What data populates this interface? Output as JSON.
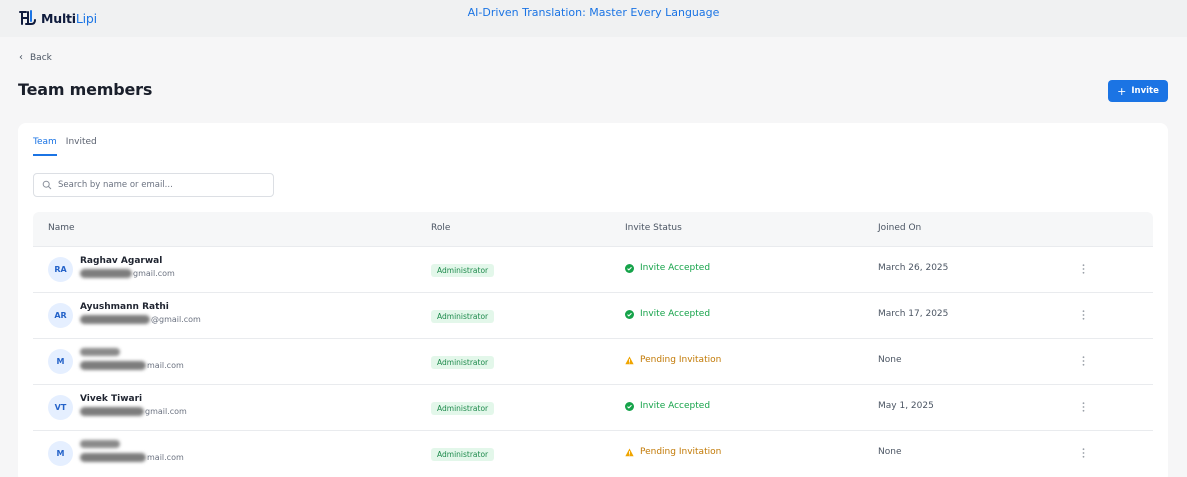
{
  "header": {
    "logo_main": "Multi",
    "logo_accent": "Lipi",
    "tagline": "AI-Driven Translation: Master Every Language"
  },
  "nav": {
    "back_label": "Back"
  },
  "page": {
    "title": "Team members",
    "invite_label": "Invite"
  },
  "tabs": [
    {
      "label": "Team",
      "active": true
    },
    {
      "label": "Invited",
      "active": false
    }
  ],
  "search": {
    "placeholder": "Search by name or email..."
  },
  "table": {
    "columns": [
      "Name",
      "Role",
      "Invite Status",
      "Joined On"
    ],
    "rows": [
      {
        "initials": "RA",
        "name": "Raghav Agarwal",
        "email_visible": "gmail.com",
        "role": "Administrator",
        "status": "Invite Accepted",
        "status_type": "accepted",
        "joined": "March 26, 2025"
      },
      {
        "initials": "AR",
        "name": "Ayushmann Rathi",
        "email_visible": "@gmail.com",
        "role": "Administrator",
        "status": "Invite Accepted",
        "status_type": "accepted",
        "joined": "March 17, 2025"
      },
      {
        "initials": "M",
        "name": "",
        "email_visible": "mail.com",
        "role": "Administrator",
        "status": "Pending Invitation",
        "status_type": "pending",
        "joined": "None"
      },
      {
        "initials": "VT",
        "name": "Vivek Tiwari",
        "email_visible": "gmail.com",
        "role": "Administrator",
        "status": "Invite Accepted",
        "status_type": "accepted",
        "joined": "May 1, 2025"
      },
      {
        "initials": "M",
        "name": "",
        "email_visible": "mail.com",
        "role": "Administrator",
        "status": "Pending Invitation",
        "status_type": "pending",
        "joined": "None"
      }
    ]
  },
  "colors": {
    "accent": "#1b74e4",
    "accepted": "#16a34a",
    "pending": "#c27a06",
    "role_badge_bg": "#e3f7ea"
  },
  "icons": {
    "logo": "multilipi-logo-icon",
    "back": "chevron-left-icon",
    "invite": "plus-icon",
    "search": "search-icon",
    "accepted": "check-circle-icon",
    "pending": "warning-triangle-icon",
    "row_menu": "kebab-menu-icon"
  }
}
